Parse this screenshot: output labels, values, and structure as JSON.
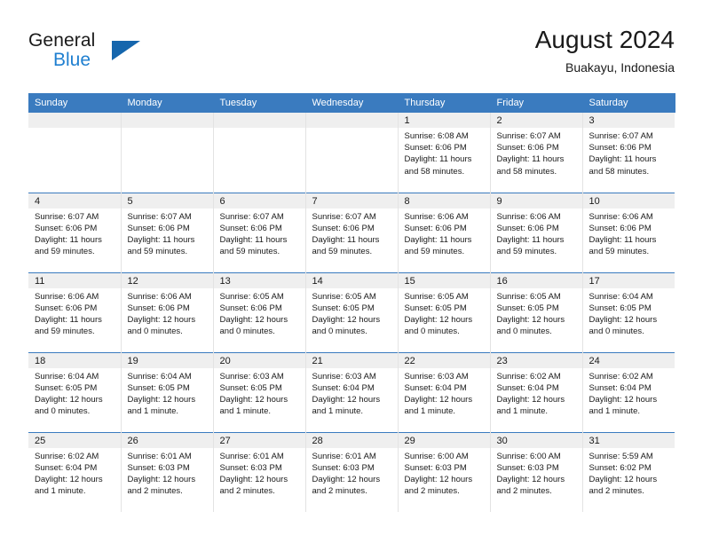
{
  "brand": {
    "line1": "General",
    "line2": "Blue",
    "triangle_color": "#1566ad",
    "blue_color": "#1f7fd0"
  },
  "header": {
    "title": "August 2024",
    "subtitle": "Buakayu, Indonesia"
  },
  "theme": {
    "header_bg": "#3a7bbf",
    "daynum_bg": "#efefef",
    "separator": "#3a7bbf"
  },
  "weekdays": [
    "Sunday",
    "Monday",
    "Tuesday",
    "Wednesday",
    "Thursday",
    "Friday",
    "Saturday"
  ],
  "weeks": [
    [
      {
        "day": "",
        "sunrise": "",
        "sunset": "",
        "daylight1": "",
        "daylight2": ""
      },
      {
        "day": "",
        "sunrise": "",
        "sunset": "",
        "daylight1": "",
        "daylight2": ""
      },
      {
        "day": "",
        "sunrise": "",
        "sunset": "",
        "daylight1": "",
        "daylight2": ""
      },
      {
        "day": "",
        "sunrise": "",
        "sunset": "",
        "daylight1": "",
        "daylight2": ""
      },
      {
        "day": "1",
        "sunrise": "Sunrise: 6:08 AM",
        "sunset": "Sunset: 6:06 PM",
        "daylight1": "Daylight: 11 hours",
        "daylight2": "and 58 minutes."
      },
      {
        "day": "2",
        "sunrise": "Sunrise: 6:07 AM",
        "sunset": "Sunset: 6:06 PM",
        "daylight1": "Daylight: 11 hours",
        "daylight2": "and 58 minutes."
      },
      {
        "day": "3",
        "sunrise": "Sunrise: 6:07 AM",
        "sunset": "Sunset: 6:06 PM",
        "daylight1": "Daylight: 11 hours",
        "daylight2": "and 58 minutes."
      }
    ],
    [
      {
        "day": "4",
        "sunrise": "Sunrise: 6:07 AM",
        "sunset": "Sunset: 6:06 PM",
        "daylight1": "Daylight: 11 hours",
        "daylight2": "and 59 minutes."
      },
      {
        "day": "5",
        "sunrise": "Sunrise: 6:07 AM",
        "sunset": "Sunset: 6:06 PM",
        "daylight1": "Daylight: 11 hours",
        "daylight2": "and 59 minutes."
      },
      {
        "day": "6",
        "sunrise": "Sunrise: 6:07 AM",
        "sunset": "Sunset: 6:06 PM",
        "daylight1": "Daylight: 11 hours",
        "daylight2": "and 59 minutes."
      },
      {
        "day": "7",
        "sunrise": "Sunrise: 6:07 AM",
        "sunset": "Sunset: 6:06 PM",
        "daylight1": "Daylight: 11 hours",
        "daylight2": "and 59 minutes."
      },
      {
        "day": "8",
        "sunrise": "Sunrise: 6:06 AM",
        "sunset": "Sunset: 6:06 PM",
        "daylight1": "Daylight: 11 hours",
        "daylight2": "and 59 minutes."
      },
      {
        "day": "9",
        "sunrise": "Sunrise: 6:06 AM",
        "sunset": "Sunset: 6:06 PM",
        "daylight1": "Daylight: 11 hours",
        "daylight2": "and 59 minutes."
      },
      {
        "day": "10",
        "sunrise": "Sunrise: 6:06 AM",
        "sunset": "Sunset: 6:06 PM",
        "daylight1": "Daylight: 11 hours",
        "daylight2": "and 59 minutes."
      }
    ],
    [
      {
        "day": "11",
        "sunrise": "Sunrise: 6:06 AM",
        "sunset": "Sunset: 6:06 PM",
        "daylight1": "Daylight: 11 hours",
        "daylight2": "and 59 minutes."
      },
      {
        "day": "12",
        "sunrise": "Sunrise: 6:06 AM",
        "sunset": "Sunset: 6:06 PM",
        "daylight1": "Daylight: 12 hours",
        "daylight2": "and 0 minutes."
      },
      {
        "day": "13",
        "sunrise": "Sunrise: 6:05 AM",
        "sunset": "Sunset: 6:06 PM",
        "daylight1": "Daylight: 12 hours",
        "daylight2": "and 0 minutes."
      },
      {
        "day": "14",
        "sunrise": "Sunrise: 6:05 AM",
        "sunset": "Sunset: 6:05 PM",
        "daylight1": "Daylight: 12 hours",
        "daylight2": "and 0 minutes."
      },
      {
        "day": "15",
        "sunrise": "Sunrise: 6:05 AM",
        "sunset": "Sunset: 6:05 PM",
        "daylight1": "Daylight: 12 hours",
        "daylight2": "and 0 minutes."
      },
      {
        "day": "16",
        "sunrise": "Sunrise: 6:05 AM",
        "sunset": "Sunset: 6:05 PM",
        "daylight1": "Daylight: 12 hours",
        "daylight2": "and 0 minutes."
      },
      {
        "day": "17",
        "sunrise": "Sunrise: 6:04 AM",
        "sunset": "Sunset: 6:05 PM",
        "daylight1": "Daylight: 12 hours",
        "daylight2": "and 0 minutes."
      }
    ],
    [
      {
        "day": "18",
        "sunrise": "Sunrise: 6:04 AM",
        "sunset": "Sunset: 6:05 PM",
        "daylight1": "Daylight: 12 hours",
        "daylight2": "and 0 minutes."
      },
      {
        "day": "19",
        "sunrise": "Sunrise: 6:04 AM",
        "sunset": "Sunset: 6:05 PM",
        "daylight1": "Daylight: 12 hours",
        "daylight2": "and 1 minute."
      },
      {
        "day": "20",
        "sunrise": "Sunrise: 6:03 AM",
        "sunset": "Sunset: 6:05 PM",
        "daylight1": "Daylight: 12 hours",
        "daylight2": "and 1 minute."
      },
      {
        "day": "21",
        "sunrise": "Sunrise: 6:03 AM",
        "sunset": "Sunset: 6:04 PM",
        "daylight1": "Daylight: 12 hours",
        "daylight2": "and 1 minute."
      },
      {
        "day": "22",
        "sunrise": "Sunrise: 6:03 AM",
        "sunset": "Sunset: 6:04 PM",
        "daylight1": "Daylight: 12 hours",
        "daylight2": "and 1 minute."
      },
      {
        "day": "23",
        "sunrise": "Sunrise: 6:02 AM",
        "sunset": "Sunset: 6:04 PM",
        "daylight1": "Daylight: 12 hours",
        "daylight2": "and 1 minute."
      },
      {
        "day": "24",
        "sunrise": "Sunrise: 6:02 AM",
        "sunset": "Sunset: 6:04 PM",
        "daylight1": "Daylight: 12 hours",
        "daylight2": "and 1 minute."
      }
    ],
    [
      {
        "day": "25",
        "sunrise": "Sunrise: 6:02 AM",
        "sunset": "Sunset: 6:04 PM",
        "daylight1": "Daylight: 12 hours",
        "daylight2": "and 1 minute."
      },
      {
        "day": "26",
        "sunrise": "Sunrise: 6:01 AM",
        "sunset": "Sunset: 6:03 PM",
        "daylight1": "Daylight: 12 hours",
        "daylight2": "and 2 minutes."
      },
      {
        "day": "27",
        "sunrise": "Sunrise: 6:01 AM",
        "sunset": "Sunset: 6:03 PM",
        "daylight1": "Daylight: 12 hours",
        "daylight2": "and 2 minutes."
      },
      {
        "day": "28",
        "sunrise": "Sunrise: 6:01 AM",
        "sunset": "Sunset: 6:03 PM",
        "daylight1": "Daylight: 12 hours",
        "daylight2": "and 2 minutes."
      },
      {
        "day": "29",
        "sunrise": "Sunrise: 6:00 AM",
        "sunset": "Sunset: 6:03 PM",
        "daylight1": "Daylight: 12 hours",
        "daylight2": "and 2 minutes."
      },
      {
        "day": "30",
        "sunrise": "Sunrise: 6:00 AM",
        "sunset": "Sunset: 6:03 PM",
        "daylight1": "Daylight: 12 hours",
        "daylight2": "and 2 minutes."
      },
      {
        "day": "31",
        "sunrise": "Sunrise: 5:59 AM",
        "sunset": "Sunset: 6:02 PM",
        "daylight1": "Daylight: 12 hours",
        "daylight2": "and 2 minutes."
      }
    ]
  ]
}
